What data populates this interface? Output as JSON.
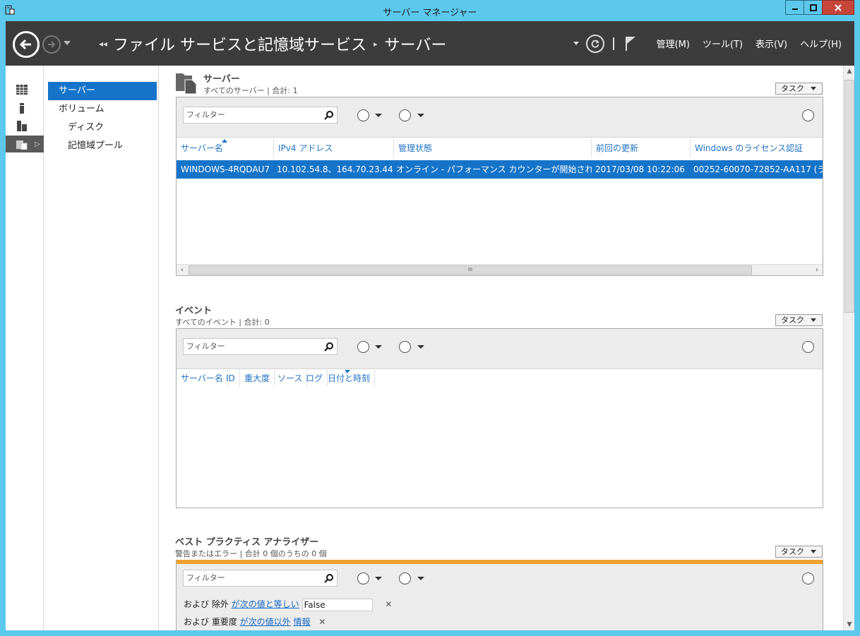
{
  "window": {
    "title": "サーバー マネージャー"
  },
  "header": {
    "breadcrumb": [
      "ファイル サービスと記憶域サービス",
      "サーバー"
    ],
    "menu": [
      "管理(M)",
      "ツール(T)",
      "表示(V)",
      "ヘルプ(H)"
    ]
  },
  "nav": {
    "items": [
      {
        "label": "サーバー",
        "selected": true
      },
      {
        "label": "ボリューム"
      },
      {
        "label": "ディスク"
      },
      {
        "label": "記憶域プール"
      }
    ]
  },
  "servers": {
    "title": "サーバー",
    "subtitle": "すべてのサーバー | 合計: 1",
    "task_label": "タスク",
    "filter_placeholder": "フィルター",
    "columns": [
      "サーバー名",
      "IPv4 アドレス",
      "管理状態",
      "前回の更新",
      "Windows のライセンス認証"
    ],
    "rows": [
      [
        "WINDOWS-4RQDAU7",
        "10.102.54.8、164.70.23.44",
        "オンライン - パフォーマンス カウンターが開始されていません",
        "2017/03/08 10:22:06",
        "00252-60070-72852-AA117 (ラ"
      ]
    ],
    "scroll_thumb": "III"
  },
  "events": {
    "title": "イベント",
    "subtitle": "すべてのイベント | 合計: 0",
    "task_label": "タスク",
    "filter_placeholder": "フィルター",
    "columns": [
      "サーバー名",
      "ID",
      "重大度",
      "ソース",
      "ログ",
      "日付と時刻"
    ]
  },
  "bpa": {
    "title": "ベスト プラクティス アナライザー",
    "subtitle": "警告またはエラー | 合計 0 個のうちの 0 個",
    "task_label": "タスク",
    "filter_placeholder": "フィルター",
    "criteria": [
      {
        "prefix": "および 除外",
        "op": "が次の値と等しい",
        "value": "False"
      },
      {
        "prefix": "および 重要度",
        "op": "が次の値以外",
        "value": "情報"
      }
    ],
    "remove_glyph": "✕"
  },
  "colors": {
    "accent": "#1574c9",
    "header_bg": "#3c3c3c",
    "bpa_warning": "#f0a030"
  }
}
